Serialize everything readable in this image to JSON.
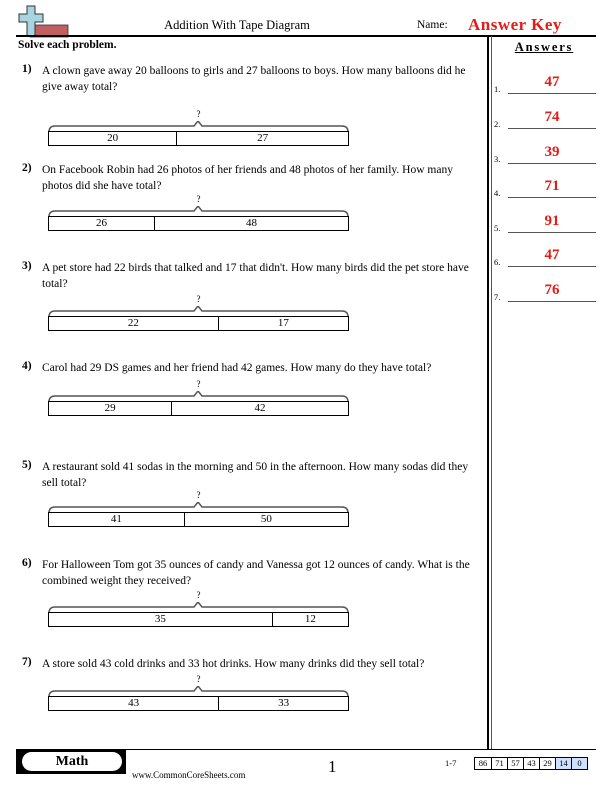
{
  "header": {
    "title": "Addition With Tape Diagram",
    "name_label": "Name:",
    "answer_key": "Answer Key",
    "instructions": "Solve each problem."
  },
  "colors": {
    "answer_red": "#e41b17",
    "logo_cross": "#a8d4e0",
    "logo_bar": "#c06060",
    "score_highlight": "#cfe0ff"
  },
  "problems": [
    {
      "number": "1)",
      "text": "A clown gave away 20 balloons to girls and 27 balloons to boys. How many balloons did he give away total?",
      "question_mark": "?",
      "parts": [
        20,
        27
      ]
    },
    {
      "number": "2)",
      "text": "On Facebook Robin had 26 photos of her friends and 48 photos of her family. How many photos did she have total?",
      "question_mark": "?",
      "parts": [
        26,
        48
      ]
    },
    {
      "number": "3)",
      "text": "A pet store had 22 birds that talked and 17 that didn't. How many birds did the pet store have total?",
      "question_mark": "?",
      "parts": [
        22,
        17
      ]
    },
    {
      "number": "4)",
      "text": "Carol had 29 DS games and her friend had 42 games. How many do they have total?",
      "question_mark": "?",
      "parts": [
        29,
        42
      ]
    },
    {
      "number": "5)",
      "text": "A restaurant sold 41 sodas in the morning and 50 in the afternoon. How many sodas did they sell total?",
      "question_mark": "?",
      "parts": [
        41,
        50
      ]
    },
    {
      "number": "6)",
      "text": "For Halloween Tom got 35 ounces of candy and Vanessa got 12 ounces of candy. What is the combined weight they received?",
      "question_mark": "?",
      "parts": [
        35,
        12
      ]
    },
    {
      "number": "7)",
      "text": "A store sold 43 cold drinks and 33 hot drinks. How many drinks did they sell total?",
      "question_mark": "?",
      "parts": [
        43,
        33
      ]
    }
  ],
  "answers": {
    "heading": "Answers",
    "items": [
      {
        "label": "1.",
        "value": "47"
      },
      {
        "label": "2.",
        "value": "74"
      },
      {
        "label": "3.",
        "value": "39"
      },
      {
        "label": "4.",
        "value": "71"
      },
      {
        "label": "5.",
        "value": "91"
      },
      {
        "label": "6.",
        "value": "47"
      },
      {
        "label": "7.",
        "value": "76"
      }
    ]
  },
  "footer": {
    "subject": "Math",
    "website": "www.CommonCoreSheets.com",
    "page_number": "1",
    "score_range": "1-7",
    "scores": [
      {
        "value": "86",
        "highlight": false
      },
      {
        "value": "71",
        "highlight": false
      },
      {
        "value": "57",
        "highlight": false
      },
      {
        "value": "43",
        "highlight": false
      },
      {
        "value": "29",
        "highlight": false
      },
      {
        "value": "14",
        "highlight": true
      },
      {
        "value": "0",
        "highlight": true
      }
    ]
  }
}
